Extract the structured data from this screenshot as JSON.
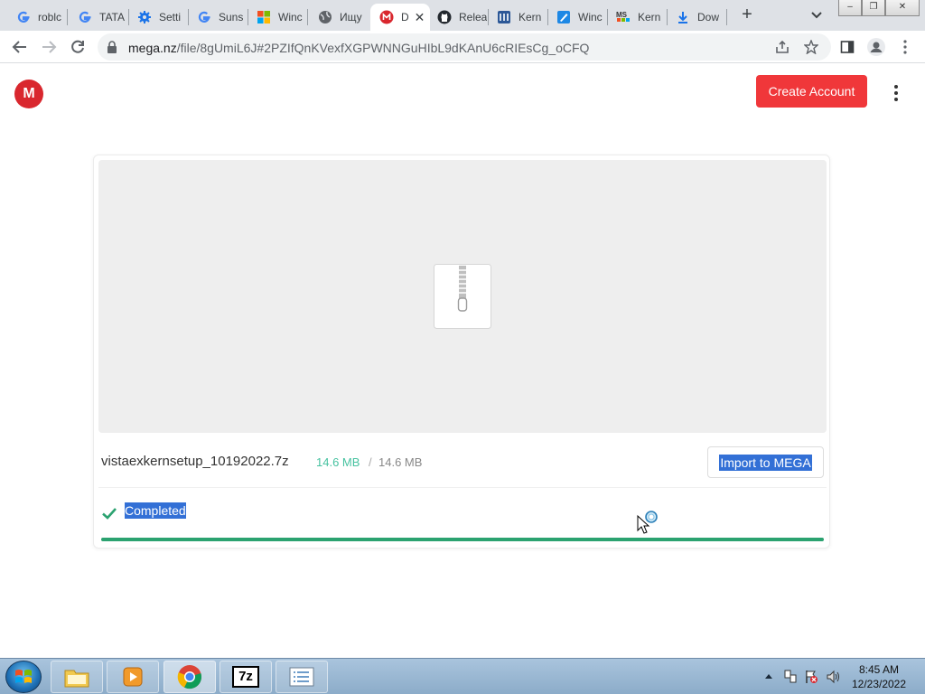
{
  "browser": {
    "tabs": [
      {
        "label": "roblc",
        "icon": "google-icon"
      },
      {
        "label": "TATA",
        "icon": "google-icon"
      },
      {
        "label": "Setti",
        "icon": "settings-gear-icon"
      },
      {
        "label": "Suns",
        "icon": "google-icon"
      },
      {
        "label": "Winc",
        "icon": "microsoft-icon"
      },
      {
        "label": "Ищу",
        "icon": "globe-icon"
      },
      {
        "label": "D",
        "icon": "mega-icon",
        "active": true
      },
      {
        "label": "Relea",
        "icon": "github-icon"
      },
      {
        "label": "Kern",
        "icon": "kernel-icon"
      },
      {
        "label": "Winc",
        "icon": "pen-icon"
      },
      {
        "label": "Kern",
        "icon": "msfn-icon"
      },
      {
        "label": "Dow",
        "icon": "download-icon"
      }
    ],
    "active_tab_close": "✕",
    "new_tab": "+",
    "window_controls": {
      "minimize": "–",
      "restore": "❐",
      "close": "✕"
    },
    "url": {
      "host": "mega.nz",
      "path": "/file/8gUmiL6J#2PZIfQnKVexfXGPWNNGuHIbL9dKAnU6cRIEsCg_oCFQ"
    }
  },
  "mega": {
    "logo_letter": "M",
    "create_account": "Create Account",
    "file": {
      "name": "vistaexkernsetup_10192022.7z",
      "downloaded": "14.6 MB",
      "separator": "/",
      "total": "14.6 MB"
    },
    "import_button": "Import to MEGA",
    "status": "Completed",
    "progress": 1.0,
    "colors": {
      "accent_red": "#f0373a",
      "logo_red": "#d9272e",
      "progress_green": "#2ba270",
      "size_green": "#47c2a0",
      "selection_blue": "#3370d6"
    }
  },
  "taskbar": {
    "items": [
      {
        "name": "explorer",
        "icon": "folder-icon"
      },
      {
        "name": "media-player",
        "icon": "media-player-icon"
      },
      {
        "name": "chrome",
        "icon": "chrome-icon",
        "active": true
      },
      {
        "name": "7zip",
        "icon": "7zip-icon",
        "label": "7z"
      },
      {
        "name": "notepad",
        "icon": "notepad-icon"
      }
    ],
    "time": "8:45 AM",
    "date": "12/23/2022"
  }
}
